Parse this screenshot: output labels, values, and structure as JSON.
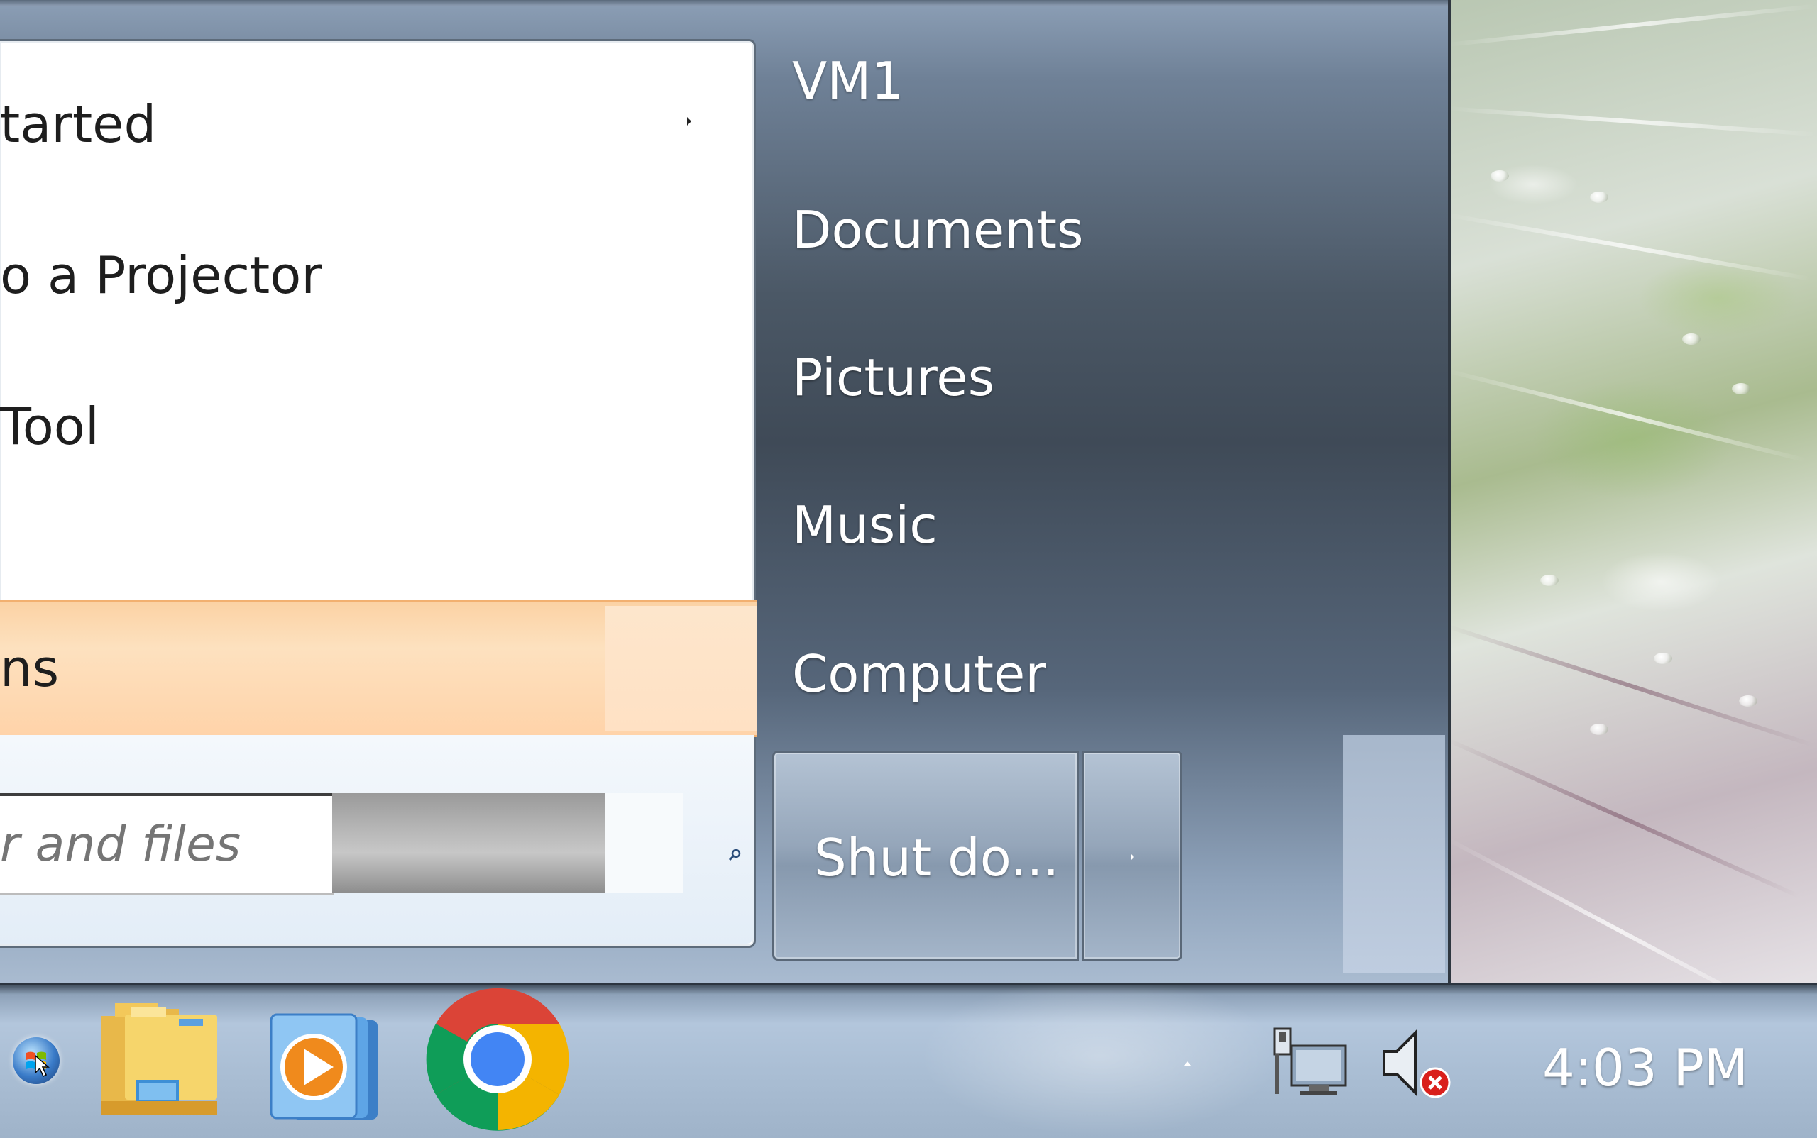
{
  "start_menu": {
    "programs": [
      {
        "label": "tarted",
        "has_submenu": true
      },
      {
        "label": "o a Projector",
        "has_submenu": false
      },
      {
        "label": "Tool",
        "has_submenu": false
      }
    ],
    "all_programs_label": "ns",
    "search": {
      "placeholder": "r and files"
    },
    "right_links": [
      {
        "label": "VM1"
      },
      {
        "label": "Documents"
      },
      {
        "label": "Pictures"
      },
      {
        "label": "Music"
      },
      {
        "label": "Computer"
      }
    ],
    "shutdown_label": "Shut do...",
    "highlight_color": "#fbd2a4"
  },
  "taskbar": {
    "pinned": [
      {
        "name": "windows-explorer-icon"
      },
      {
        "name": "windows-media-player-icon"
      },
      {
        "name": "google-chrome-icon"
      }
    ],
    "tray_icons": [
      "network-icon",
      "volume-muted-icon"
    ],
    "clock": "4:03 PM"
  }
}
